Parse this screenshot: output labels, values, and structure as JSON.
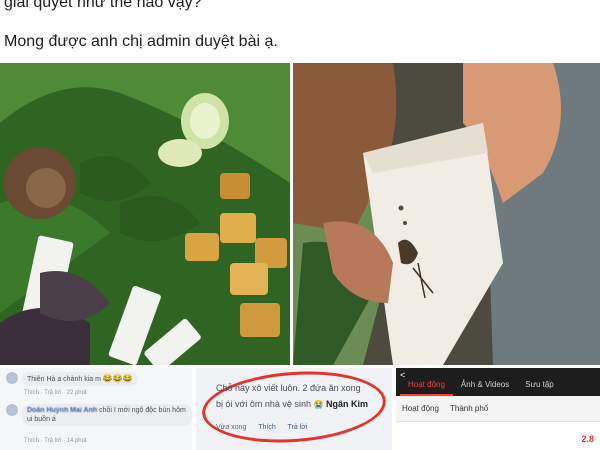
{
  "post": {
    "line1": "giải quyết như thế nào vậy?",
    "line2": "Mong được anh chị admin duyệt bài ạ."
  },
  "photos": {
    "left": "banana-leaf-plate-with-rice-cake-tofu-and-herbs",
    "right": "hand-holding-rice-cake-with-insect-stain"
  },
  "comments_left": {
    "c1_text": "Thiên Hà a chành kia m",
    "c1_emoji": "😂😂😂",
    "c1_meta": "Thích · Trả lời · 22 phút",
    "c2_name": "Doãn Huỳnh Mai Anh",
    "c2_text": "chồi I mới ngộ độc bún hôm ui buồn á",
    "c2_meta": "Thích · Trả lời · 14 phút"
  },
  "comment_highlight": {
    "line1": "Chỗ này xô viết luôn. 2 đứa ăn xong",
    "line2": "bị ói với ôm nhà vệ sinh",
    "emoji": "😭",
    "name": "Ngân Kim",
    "actions": [
      "Vừa xong",
      "Thích",
      "Trả lời"
    ],
    "ring_color": "#e5332a"
  },
  "app_panel": {
    "back": "<",
    "tabs": [
      "Hoạt động",
      "Ảnh & Videos",
      "Sưu tập"
    ],
    "sub_left": "Hoạt động",
    "sub_right": "Thành phố",
    "score": "2.8",
    "accent": "#ff3b3b"
  }
}
